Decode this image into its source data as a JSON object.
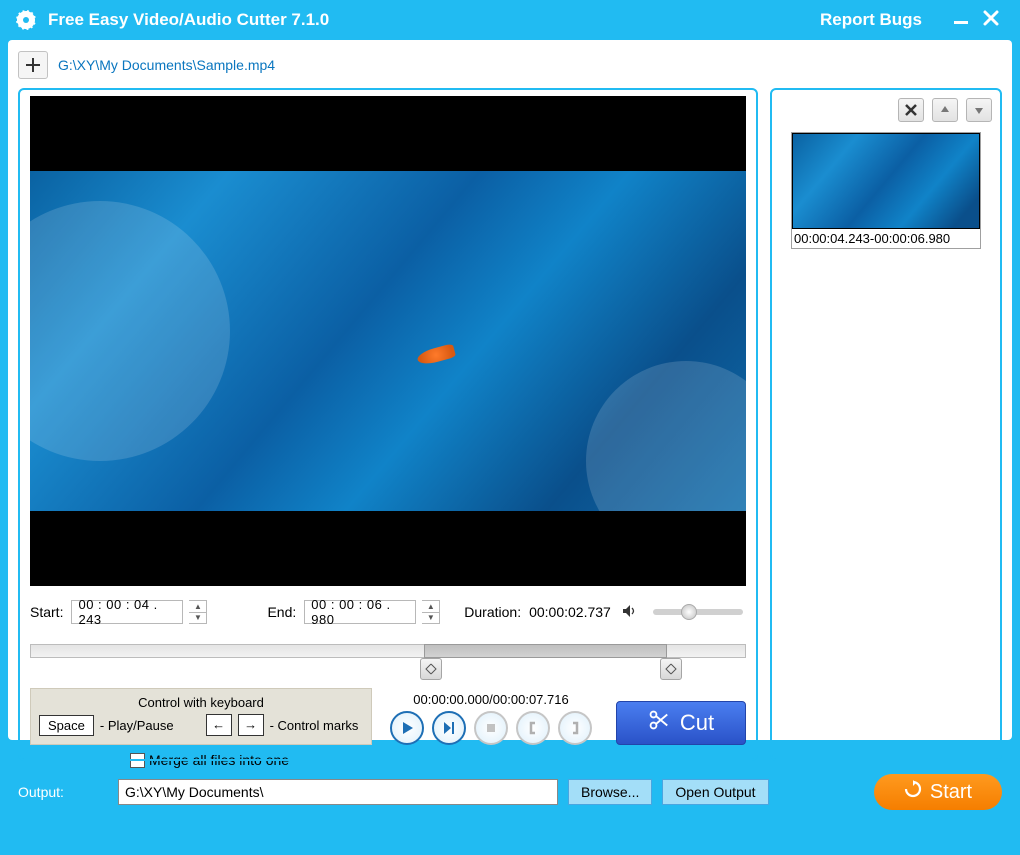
{
  "titlebar": {
    "app_title": "Free Easy Video/Audio Cutter 7.1.0",
    "report_bugs": "Report Bugs"
  },
  "file": {
    "path": "G:\\XY\\My Documents\\Sample.mp4"
  },
  "time": {
    "start_label": "Start:",
    "start_value": "00 : 00 : 04 . 243",
    "end_label": "End:",
    "end_value": "00 : 00 : 06 . 980",
    "duration_label": "Duration:",
    "duration_value": "00:00:02.737"
  },
  "playback": {
    "timecode": "00:00:00.000/00:00:07.716"
  },
  "keyboard": {
    "title": "Control with keyboard",
    "space_key": "Space",
    "space_text": "- Play/Pause",
    "left_key": "←",
    "right_key": "→",
    "marks_text": "- Control marks"
  },
  "cut": {
    "label": "Cut"
  },
  "clip": {
    "range": "00:00:04.243-00:00:06.980"
  },
  "footer": {
    "merge_label": "Merge all files into one",
    "output_label": "Output:",
    "output_path": "G:\\XY\\My Documents\\",
    "browse": "Browse...",
    "open_output": "Open Output",
    "start": "Start"
  }
}
